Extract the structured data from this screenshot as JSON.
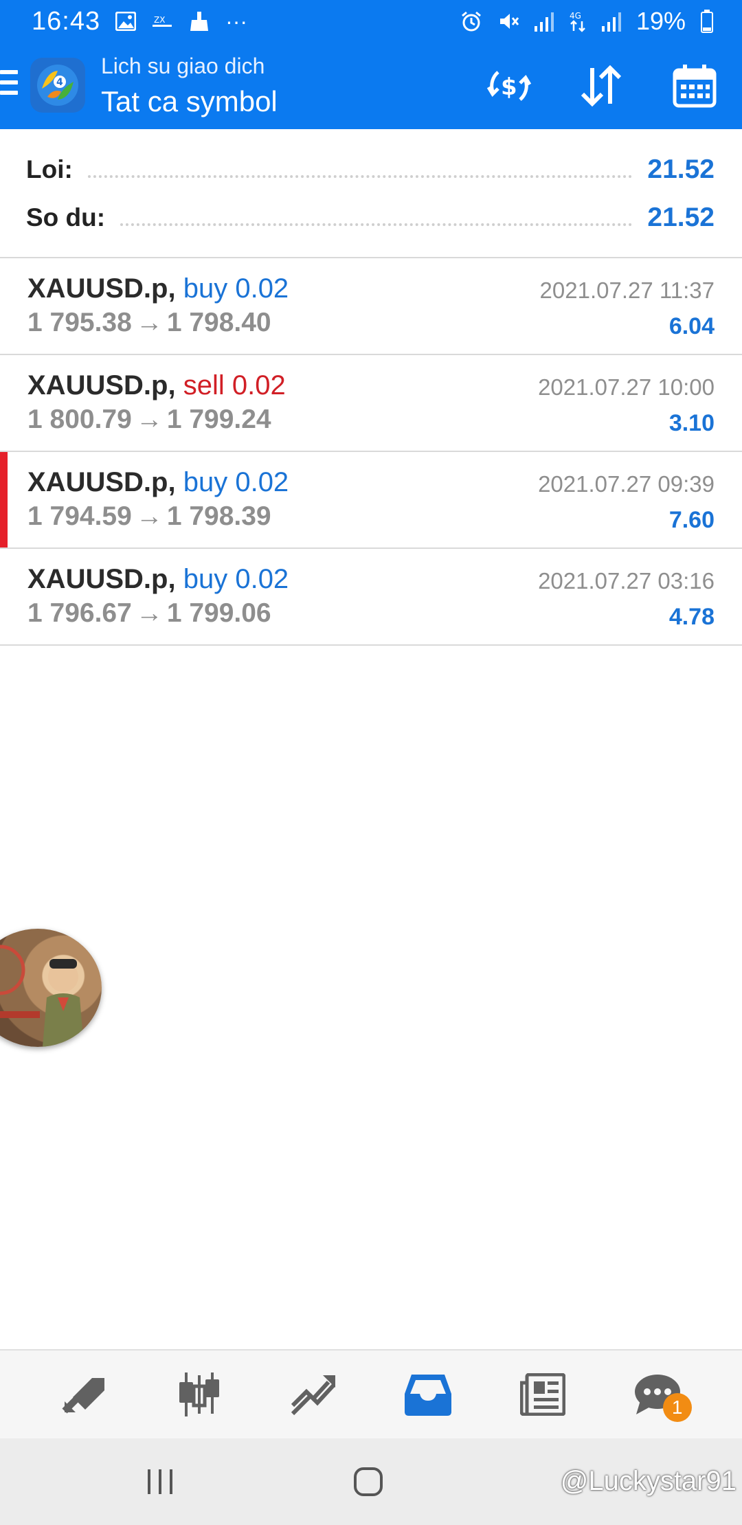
{
  "status_bar": {
    "time": "16:43",
    "battery": "19%",
    "network": "4G",
    "more": "···"
  },
  "app_bar": {
    "subtitle": "Lich su giao dich",
    "title": "Tat ca symbol"
  },
  "summary": {
    "profit_label": "Loi:",
    "profit_value": "21.52",
    "balance_label": "So du:",
    "balance_value": "21.52"
  },
  "trades": [
    {
      "symbol": "XAUUSD.p,",
      "type": "buy",
      "volume": "0.02",
      "open": "1 795.38",
      "close": "1 798.40",
      "time": "2021.07.27 11:37",
      "profit": "6.04"
    },
    {
      "symbol": "XAUUSD.p,",
      "type": "sell",
      "volume": "0.02",
      "open": "1 800.79",
      "close": "1 799.24",
      "time": "2021.07.27 10:00",
      "profit": "3.10"
    },
    {
      "symbol": "XAUUSD.p,",
      "type": "buy",
      "volume": "0.02",
      "open": "1 794.59",
      "close": "1 798.39",
      "time": "2021.07.27 09:39",
      "profit": "7.60"
    },
    {
      "symbol": "XAUUSD.p,",
      "type": "buy",
      "volume": "0.02",
      "open": "1 796.67",
      "close": "1 799.06",
      "time": "2021.07.27 03:16",
      "profit": "4.78"
    }
  ],
  "arrow": "→",
  "bottom_nav": {
    "items": [
      "quotes",
      "chart",
      "trade",
      "history",
      "news",
      "chat"
    ],
    "active": "history",
    "chat_badge": "1"
  },
  "watermark": "@Luckystar91",
  "colors": {
    "primary": "#0b7af0",
    "profit": "#1a73d6",
    "sell": "#d11f26",
    "marker": "#e5202a",
    "badge": "#f28c13"
  }
}
